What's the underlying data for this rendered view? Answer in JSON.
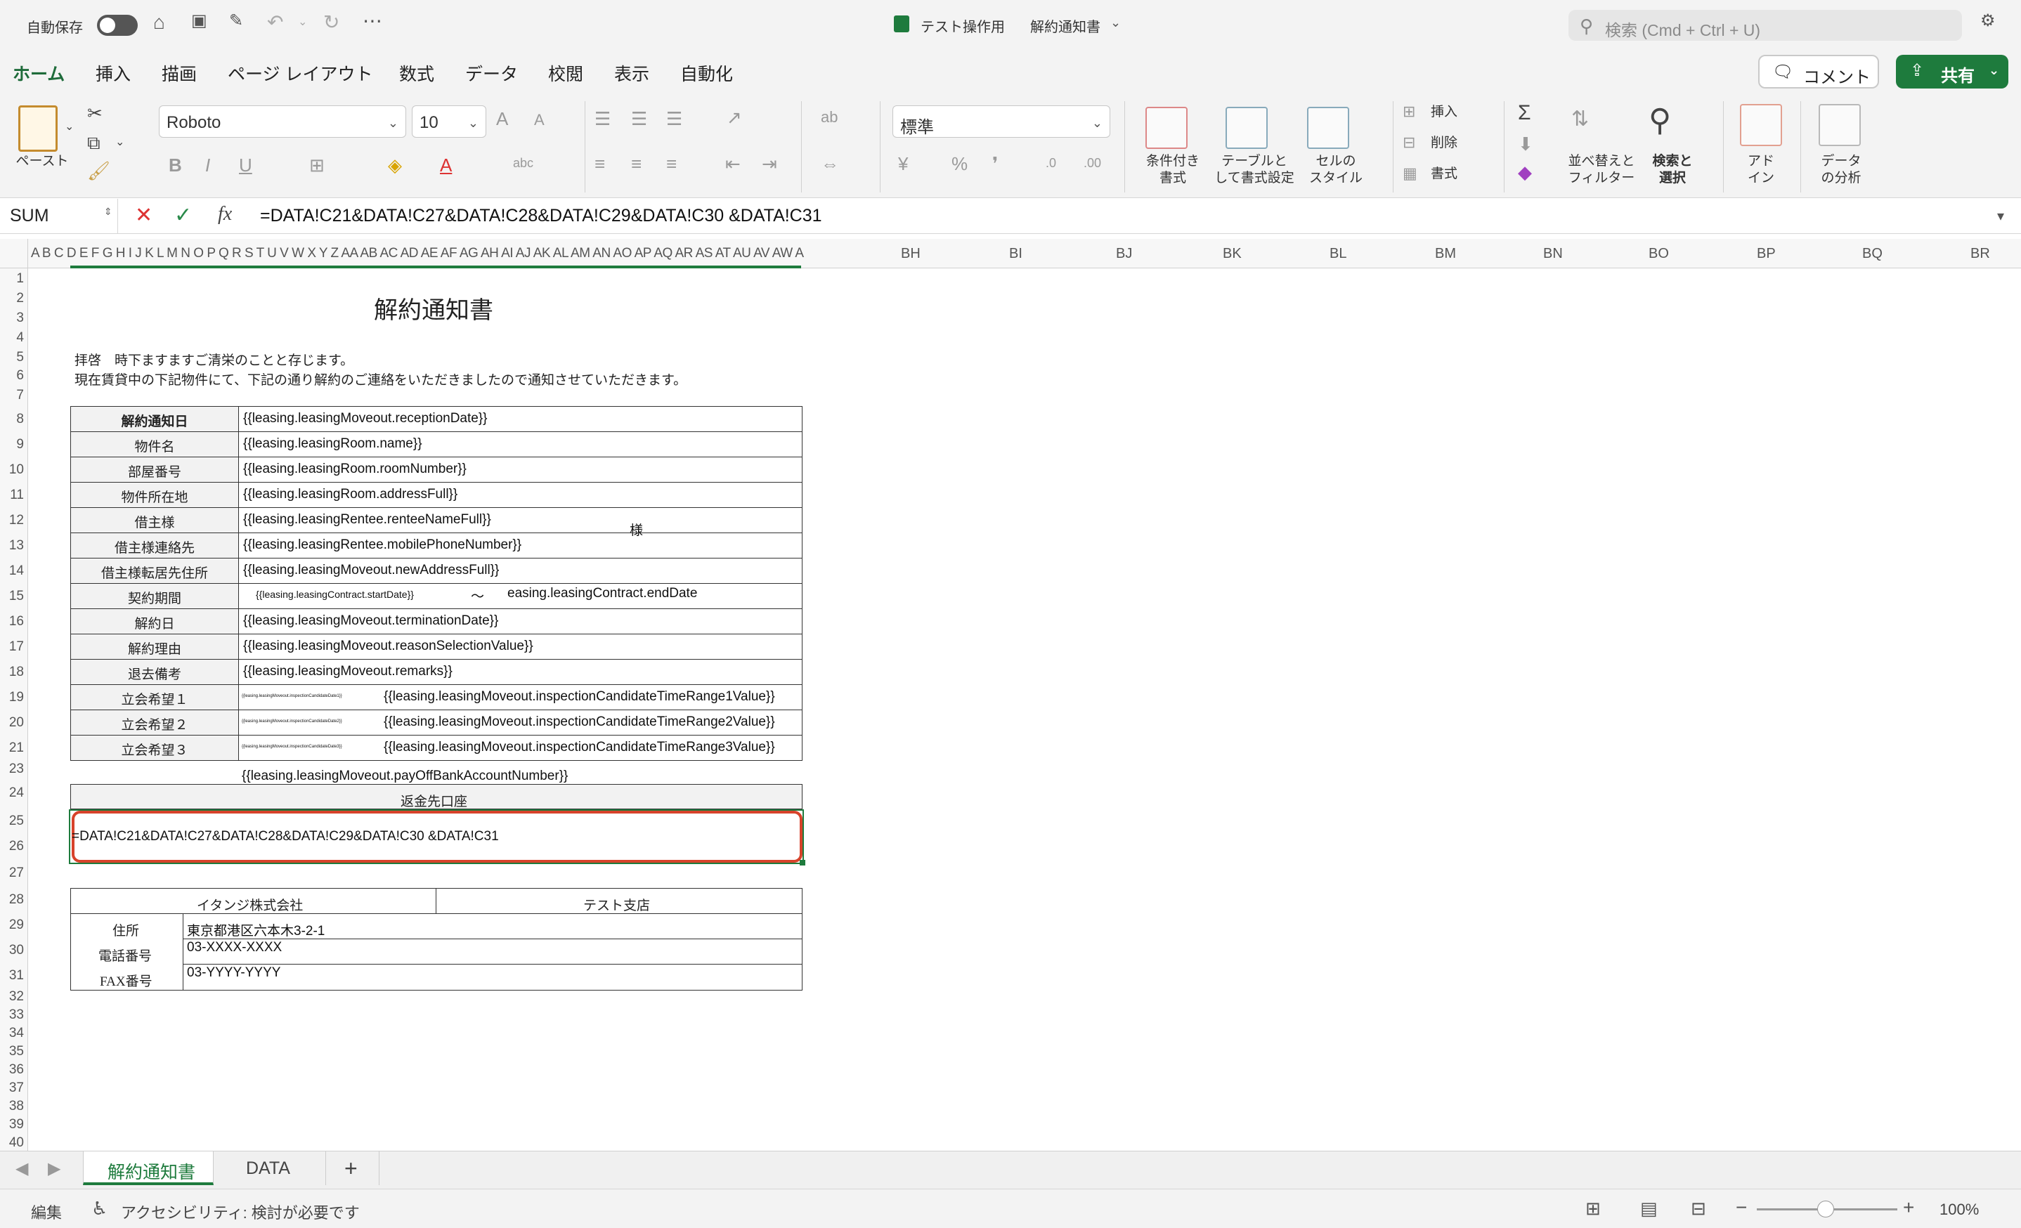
{
  "titlebar": {
    "autosave_label": "自動保存",
    "file_name": "テスト操作用",
    "sheet_title": "解約通知書",
    "search_placeholder": "検索 (Cmd + Ctrl + U)"
  },
  "ribbon_tabs": [
    "ホーム",
    "挿入",
    "描画",
    "ページ レイアウト",
    "数式",
    "データ",
    "校閲",
    "表示",
    "自動化"
  ],
  "buttons": {
    "comment": "コメント",
    "share": "共有"
  },
  "ribbon": {
    "paste_label": "ペースト",
    "font_name": "Roboto",
    "font_size": "10",
    "number_format": "標準",
    "insert_label": "挿入",
    "delete_label": "削除",
    "format_label": "書式",
    "cond_format": [
      "条件付き",
      "書式"
    ],
    "table_format": [
      "テーブルと",
      "して書式設定"
    ],
    "cell_style": [
      "セルの",
      "スタイル"
    ],
    "sort_filter": [
      "並べ替えと",
      "フィルター"
    ],
    "find_select": [
      "検索と",
      "選択"
    ],
    "addins": [
      "アド",
      "イン"
    ],
    "analyze": [
      "データ",
      "の分析"
    ]
  },
  "formula_bar": {
    "name_box": "SUM",
    "formula": "=DATA!C21&DATA!C27&DATA!C28&DATA!C29&DATA!C30 &DATA!C31"
  },
  "columns_compact": "A B C D E F G H I  J K L M N O P Q R S T U V W X Y Z AA AB AC AD AE AF AG AH AI AJ AK AL AM AN AO AP AQ AR AS AT AU AV AW AX AY AZ BA BB BC BD BE BF BG",
  "columns_wide": [
    "BH",
    "BI",
    "BJ",
    "BK",
    "BL",
    "BM",
    "BN",
    "BO",
    "BP",
    "BQ",
    "BR"
  ],
  "document": {
    "title": "解約通知書",
    "greeting1": "拝啓　時下ますますご清栄のことと存じます。",
    "greeting2": "現在賃貸中の下記物件にて、下記の通り解約のご連絡をいただきましたので通知させていただきます。",
    "table": [
      {
        "label": "解約通知日",
        "value": "{{leasing.leasingMoveout.receptionDate}}"
      },
      {
        "label": "物件名",
        "value": "{{leasing.leasingRoom.name}}"
      },
      {
        "label": "部屋番号",
        "value": "{{leasing.leasingRoom.roomNumber}}"
      },
      {
        "label": "物件所在地",
        "value": "{{leasing.leasingRoom.addressFull}}"
      },
      {
        "label": "借主様",
        "value": "{{leasing.leasingRentee.renteeNameFull}}"
      },
      {
        "label": "借主様連絡先",
        "value": "{{leasing.leasingRentee.mobilePhoneNumber}}"
      },
      {
        "label": "借主様転居先住所",
        "value": "{{leasing.leasingMoveout.newAddressFull}}"
      },
      {
        "label": "契約期間",
        "value": ""
      },
      {
        "label": "解約日",
        "value": "{{leasing.leasingMoveout.terminationDate}}"
      },
      {
        "label": "解約理由",
        "value": "{{leasing.leasingMoveout.reasonSelectionValue}}"
      },
      {
        "label": "退去備考",
        "value": "{{leasing.leasingMoveout.remarks}}"
      },
      {
        "label": "立会希望１",
        "value": "{{leasing.leasingMoveout.inspectionCandidateTimeRange1Value}}"
      },
      {
        "label": "立会希望２",
        "value": "{{leasing.leasingMoveout.inspectionCandidateTimeRange2Value}}"
      },
      {
        "label": "立会希望３",
        "value": "{{leasing.leasingMoveout.inspectionCandidateTimeRange3Value}}"
      }
    ],
    "renter_suffix": "様",
    "contract_start": "{{leasing.leasingContract.startDate}}",
    "contract_tilde": "〜",
    "contract_end": "easing.leasingContract.endDate",
    "inspection_date_1": "{{leasing.leasingMoveout.inspectionCandidateDate1}}",
    "inspection_date_2": "{{leasing.leasingMoveout.inspectionCandidateDate2}}",
    "inspection_date_3": "{{leasing.leasingMoveout.inspectionCandidateDate3}}",
    "bank_account": "{{leasing.leasingMoveout.payOffBankAccountNumber}}",
    "refund_header": "返金先口座",
    "editing_cell": "=DATA!C21&DATA!C27&DATA!C28&DATA!C29&DATA!C30 &DATA!C31",
    "company": "イタンジ株式会社",
    "branch": "テスト支店",
    "address_label": "住所",
    "address_value": "東京都港区六本木3-2-1",
    "phone_label": "電話番号",
    "phone_value": "03-XXXX-XXXX",
    "fax_label": "FAX番号",
    "fax_value": "03-YYYY-YYYY"
  },
  "row_numbers": [
    "1",
    "2",
    "3",
    "4",
    "5",
    "6",
    "7",
    "8",
    "9",
    "10",
    "11",
    "12",
    "13",
    "14",
    "15",
    "16",
    "17",
    "18",
    "19",
    "20",
    "21",
    "23",
    "24",
    "25",
    "26",
    "27",
    "28",
    "29",
    "30",
    "31",
    "32",
    "33",
    "34",
    "35",
    "36",
    "37",
    "38",
    "39",
    "40"
  ],
  "sheet_tabs": [
    "解約通知書",
    "DATA"
  ],
  "status": {
    "mode": "編集",
    "accessibility": "アクセシビリティ: 検討が必要です",
    "zoom": "100%"
  },
  "colors": {
    "accent": "#1e6b3a",
    "share_bg": "#1e7b3d",
    "edit_outline": "#d7432b"
  }
}
